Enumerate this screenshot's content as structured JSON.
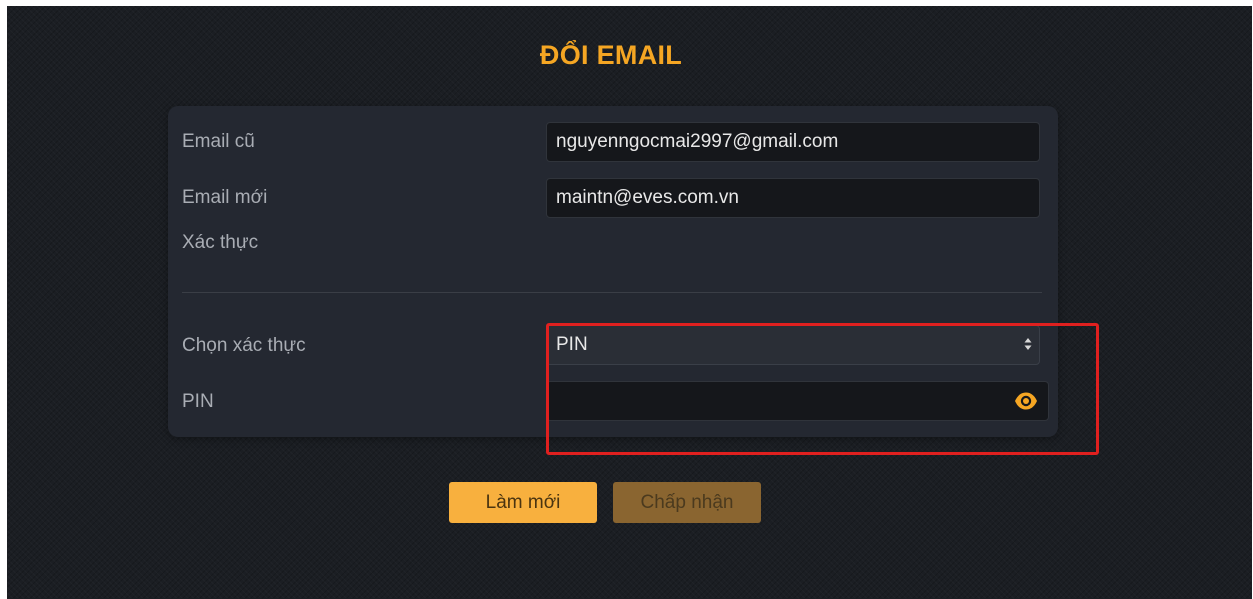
{
  "page": {
    "title": "ĐỔI EMAIL"
  },
  "form": {
    "old_email": {
      "label": "Email cũ",
      "value": "nguyenngocmai2997@gmail.com"
    },
    "new_email": {
      "label": "Email mới",
      "value": "maintn@eves.com.vn"
    },
    "verify_section_label": "Xác thực",
    "verify_method": {
      "label": "Chọn xác thực",
      "selected": "PIN"
    },
    "pin": {
      "label": "PIN",
      "value": ""
    }
  },
  "actions": {
    "refresh_label": "Làm mới",
    "accept_label": "Chấp nhận"
  },
  "icons": {
    "eye": "eye-icon",
    "select": "chevron-up-down-icon"
  },
  "colors": {
    "accent": "#f5a623",
    "primary_button": "#f8b03e",
    "disabled_button": "#8a6530",
    "highlight": "#e0201f",
    "background": "#1b1e23",
    "card": "#242831"
  }
}
